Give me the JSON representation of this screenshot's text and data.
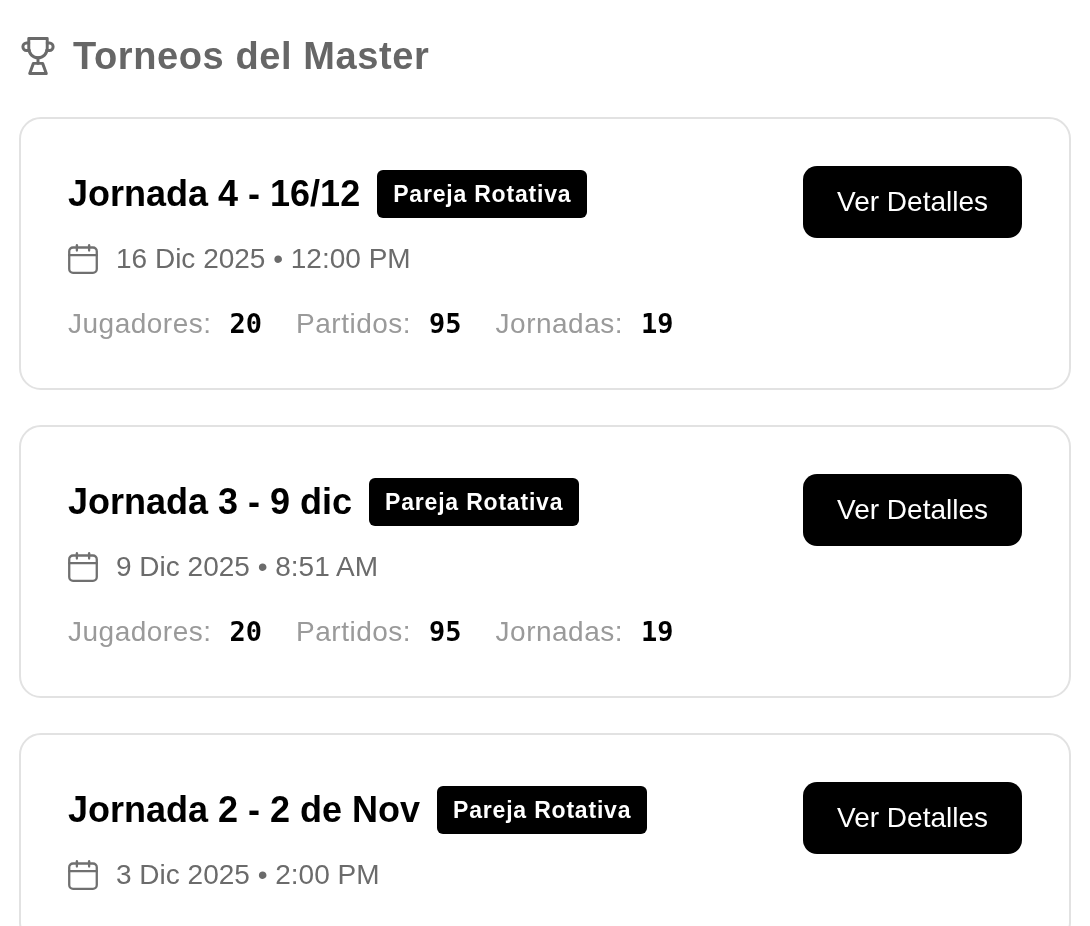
{
  "header": {
    "title": "Torneos del Master"
  },
  "tournaments": [
    {
      "title": "Jornada 4 - 16/12",
      "badge": "Pareja Rotativa",
      "datetime": "16 Dic 2025 • 12:00 PM",
      "stats": [
        {
          "label": "Jugadores:",
          "value": "20"
        },
        {
          "label": "Partidos:",
          "value": "95"
        },
        {
          "label": "Jornadas:",
          "value": "19"
        }
      ],
      "button": "Ver Detalles"
    },
    {
      "title": "Jornada 3 - 9 dic",
      "badge": "Pareja Rotativa",
      "datetime": "9 Dic 2025 • 8:51 AM",
      "stats": [
        {
          "label": "Jugadores:",
          "value": "20"
        },
        {
          "label": "Partidos:",
          "value": "95"
        },
        {
          "label": "Jornadas:",
          "value": "19"
        }
      ],
      "button": "Ver Detalles"
    },
    {
      "title": "Jornada 2 - 2 de Nov",
      "badge": "Pareja Rotativa",
      "datetime": "3 Dic 2025 • 2:00 PM",
      "button": "Ver Detalles"
    }
  ]
}
